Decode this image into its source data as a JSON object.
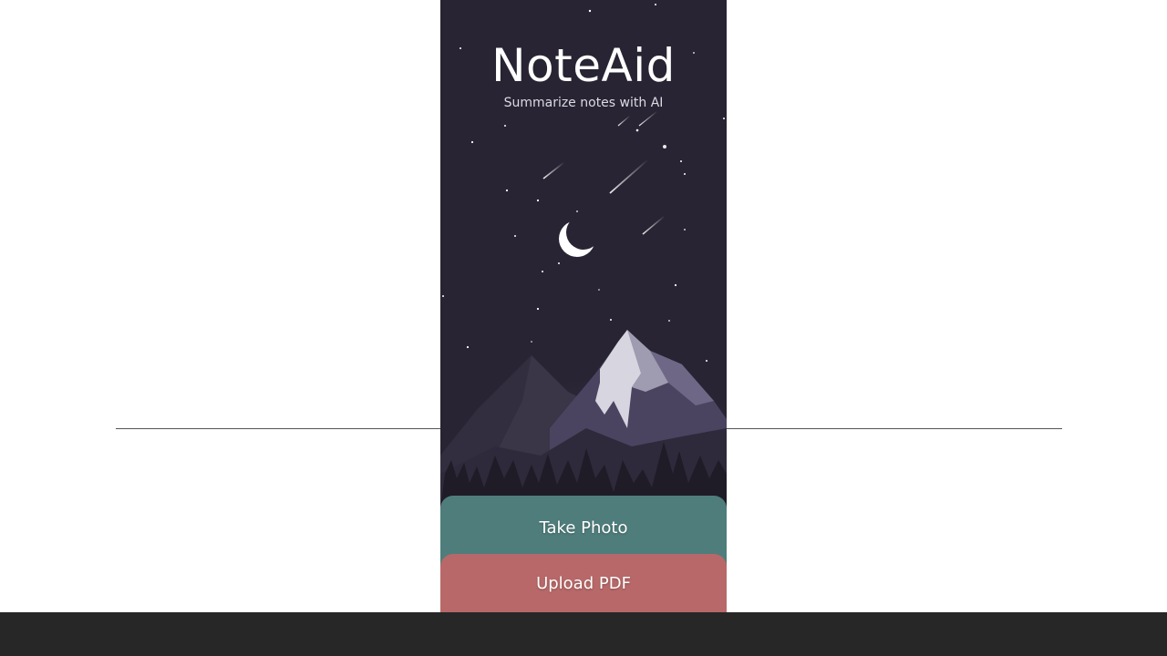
{
  "app": {
    "title": "NoteAid",
    "subtitle": "Summarize notes with AI"
  },
  "actions": {
    "take_photo_label": "Take Photo",
    "upload_pdf_label": "Upload PDF"
  },
  "colors": {
    "background": "#282433",
    "take_photo_button": "#4f7d7b",
    "upload_pdf_button": "#b86868",
    "bottom_bar": "#272727",
    "page": "#ffffff"
  },
  "icons": {
    "illustration": "night-sky-mountain-illustration",
    "moon": "crescent-moon-icon"
  }
}
